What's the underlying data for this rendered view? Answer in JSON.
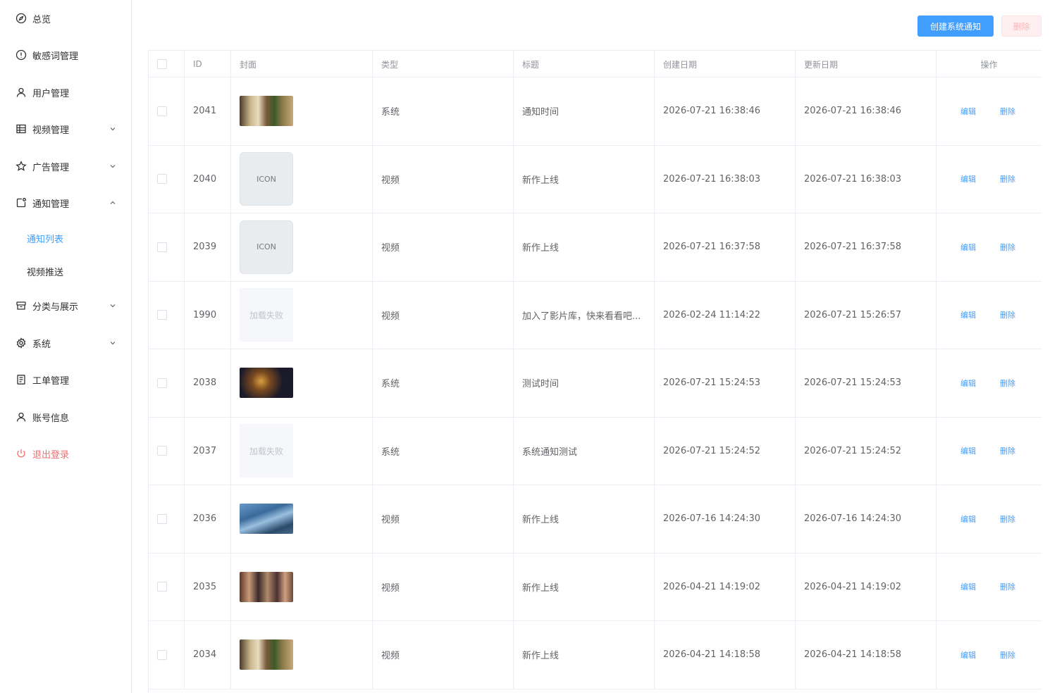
{
  "sidebar": {
    "items": [
      {
        "label": "总览",
        "icon": "compass-icon",
        "expandable": false
      },
      {
        "label": "敏感词管理",
        "icon": "alert-circle-icon",
        "expandable": false
      },
      {
        "label": "用户管理",
        "icon": "user-icon",
        "expandable": false
      },
      {
        "label": "视频管理",
        "icon": "grid-icon",
        "expandable": true,
        "expanded": false
      },
      {
        "label": "广告管理",
        "icon": "star-icon",
        "expandable": true,
        "expanded": false
      },
      {
        "label": "通知管理",
        "icon": "notification-icon",
        "expandable": true,
        "expanded": true
      },
      {
        "label": "分类与展示",
        "icon": "box-icon",
        "expandable": true,
        "expanded": false
      },
      {
        "label": "系统",
        "icon": "gear-icon",
        "expandable": true,
        "expanded": false
      },
      {
        "label": "工单管理",
        "icon": "document-icon",
        "expandable": false
      },
      {
        "label": "账号信息",
        "icon": "user-icon",
        "expandable": false
      },
      {
        "label": "退出登录",
        "icon": "power-icon",
        "expandable": false
      }
    ],
    "sub_items": [
      {
        "label": "通知列表",
        "active": true
      },
      {
        "label": "视频推送",
        "active": false
      }
    ]
  },
  "toolbar": {
    "create_label": "创建系统通知",
    "delete_label": "删除"
  },
  "table": {
    "headers": [
      "ID",
      "封面",
      "类型",
      "标题",
      "创建日期",
      "更新日期",
      "操作"
    ],
    "edit_label": "编辑",
    "delete_label": "删除",
    "rows": [
      {
        "id": "2041",
        "cover": "image",
        "cover_style": "scene-a",
        "type": "系统",
        "title": "通知时间",
        "created": "2026-07-21 16:38:46",
        "updated": "2026-07-21 16:38:46"
      },
      {
        "id": "2040",
        "cover": "icon",
        "cover_text": "ICON",
        "type": "视频",
        "title": "新作上线",
        "created": "2026-07-21 16:38:03",
        "updated": "2026-07-21 16:38:03"
      },
      {
        "id": "2039",
        "cover": "icon",
        "cover_text": "ICON",
        "type": "视频",
        "title": "新作上线",
        "created": "2026-07-21 16:37:58",
        "updated": "2026-07-21 16:37:58"
      },
      {
        "id": "1990",
        "cover": "fail",
        "cover_text": "加载失败",
        "type": "视频",
        "title": "加入了影片库，快来看看吧...",
        "created": "2026-02-24 11:14:22",
        "updated": "2026-07-21 15:26:57"
      },
      {
        "id": "2038",
        "cover": "image",
        "cover_style": "scene-b",
        "type": "系统",
        "title": "测试时间",
        "created": "2026-07-21 15:24:53",
        "updated": "2026-07-21 15:24:53"
      },
      {
        "id": "2037",
        "cover": "fail",
        "cover_text": "加载失败",
        "type": "系统",
        "title": "系统通知测试",
        "created": "2026-07-21 15:24:52",
        "updated": "2026-07-21 15:24:52"
      },
      {
        "id": "2036",
        "cover": "image",
        "cover_style": "scene-c",
        "type": "视频",
        "title": "新作上线",
        "created": "2026-07-16 14:24:30",
        "updated": "2026-07-16 14:24:30"
      },
      {
        "id": "2035",
        "cover": "image",
        "cover_style": "scene-d",
        "type": "视频",
        "title": "新作上线",
        "created": "2026-04-21 14:19:02",
        "updated": "2026-04-21 14:19:02"
      },
      {
        "id": "2034",
        "cover": "image",
        "cover_style": "scene-a",
        "type": "视频",
        "title": "新作上线",
        "created": "2026-04-21 14:18:58",
        "updated": "2026-04-21 14:18:58"
      }
    ]
  },
  "colors": {
    "primary": "#409eff",
    "danger": "#f56c6c",
    "border": "#ebeef5",
    "header_text": "#909399"
  }
}
